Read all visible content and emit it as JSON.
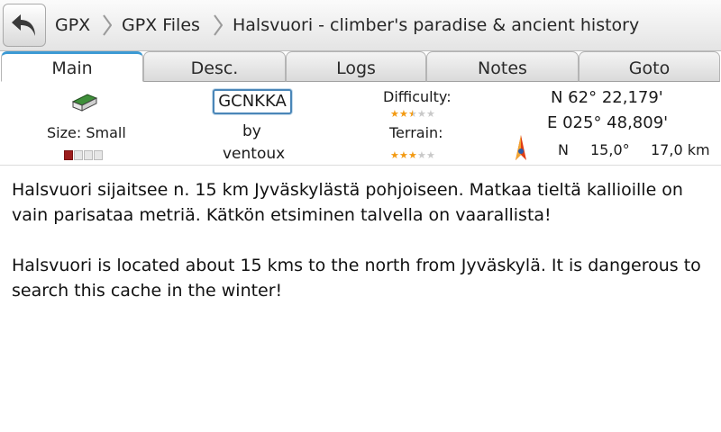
{
  "breadcrumb": {
    "items": [
      "GPX",
      "GPX Files",
      "Halsvuori - climber's paradise & ancient history"
    ]
  },
  "tabs": [
    {
      "label": "Main",
      "active": true
    },
    {
      "label": "Desc.",
      "active": false
    },
    {
      "label": "Logs",
      "active": false
    },
    {
      "label": "Notes",
      "active": false
    },
    {
      "label": "Goto",
      "active": false
    }
  ],
  "cache": {
    "size_label": "Size: Small",
    "size_level": 1,
    "size_max": 4,
    "code": "GCNKKA",
    "by_label": "by",
    "owner": "ventoux",
    "difficulty_label": "Difficulty:",
    "difficulty": 2.5,
    "terrain_label": "Terrain:",
    "terrain": 3,
    "star_max": 5,
    "lat": "N 62° 22,179'",
    "lon": "E 025° 48,809'",
    "compass_direction": "N",
    "bearing": "15,0°",
    "distance": "17,0 km"
  },
  "description": {
    "fi": "Halsvuori sijaitsee n. 15 km Jyväskylästä pohjoiseen. Matkaa tieltä kallioille on vain parisataa metriä. Kätkön etsiminen talvella on vaarallista!",
    "en": "Halsvuori is located about 15 kms to the north from Jyväskylä. It is dangerous to search this cache in the winter!"
  },
  "colors": {
    "accent": "#3c9ad4",
    "star_on": "#f39a12",
    "star_off": "#c9c9c9",
    "size_on": "#9c1c1c"
  },
  "icons": {
    "back": "back-arrow-icon",
    "cache_type": "cache-container-icon",
    "compass": "compass-needle-icon"
  }
}
